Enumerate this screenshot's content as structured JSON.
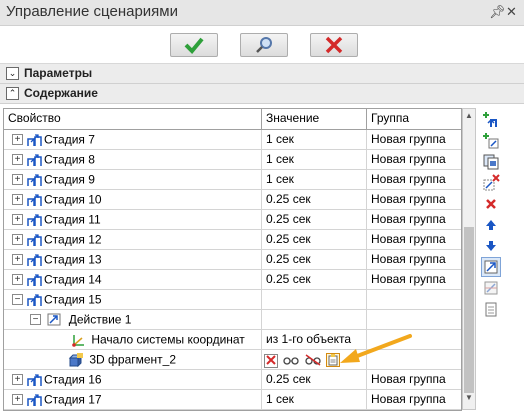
{
  "window": {
    "title": "Управление сценариями"
  },
  "toolbar": {
    "ok": "check-icon",
    "find": "magnifier-icon",
    "cancel": "cancel-icon"
  },
  "sections": {
    "params": "Параметры",
    "content": "Содержание"
  },
  "grid": {
    "headers": [
      "Свойство",
      "Значение",
      "Группа"
    ],
    "rows": [
      {
        "name": "Стадия 7",
        "value": "1 сек",
        "group": "Новая группа"
      },
      {
        "name": "Стадия 8",
        "value": "1 сек",
        "group": "Новая группа"
      },
      {
        "name": "Стадия 9",
        "value": "1 сек",
        "group": "Новая группа"
      },
      {
        "name": "Стадия 10",
        "value": "0.25 сек",
        "group": "Новая группа"
      },
      {
        "name": "Стадия 11",
        "value": "0.25 сек",
        "group": "Новая группа"
      },
      {
        "name": "Стадия 12",
        "value": "0.25 сек",
        "group": "Новая группа"
      },
      {
        "name": "Стадия 13",
        "value": "0.25 сек",
        "group": "Новая группа"
      },
      {
        "name": "Стадия 14",
        "value": "0.25 сек",
        "group": "Новая группа"
      },
      {
        "name": "Стадия 15",
        "value": "",
        "group": ""
      }
    ],
    "action": {
      "name": "Действие 1"
    },
    "coord": {
      "name": "Начало системы координат",
      "value": "из 1-го объекта"
    },
    "fragment": {
      "name": "3D фрагмент_2"
    },
    "rows_after": [
      {
        "name": "Стадия 16",
        "value": "0.25 сек",
        "group": "Новая группа"
      },
      {
        "name": "Стадия 17",
        "value": "1 сек",
        "group": "Новая группа"
      }
    ]
  },
  "colors": {
    "accent_arrow": "#f2a81d",
    "ok_green": "#2ea03a",
    "cancel_red": "#d42a2a",
    "link_blue": "#1a56c4"
  }
}
